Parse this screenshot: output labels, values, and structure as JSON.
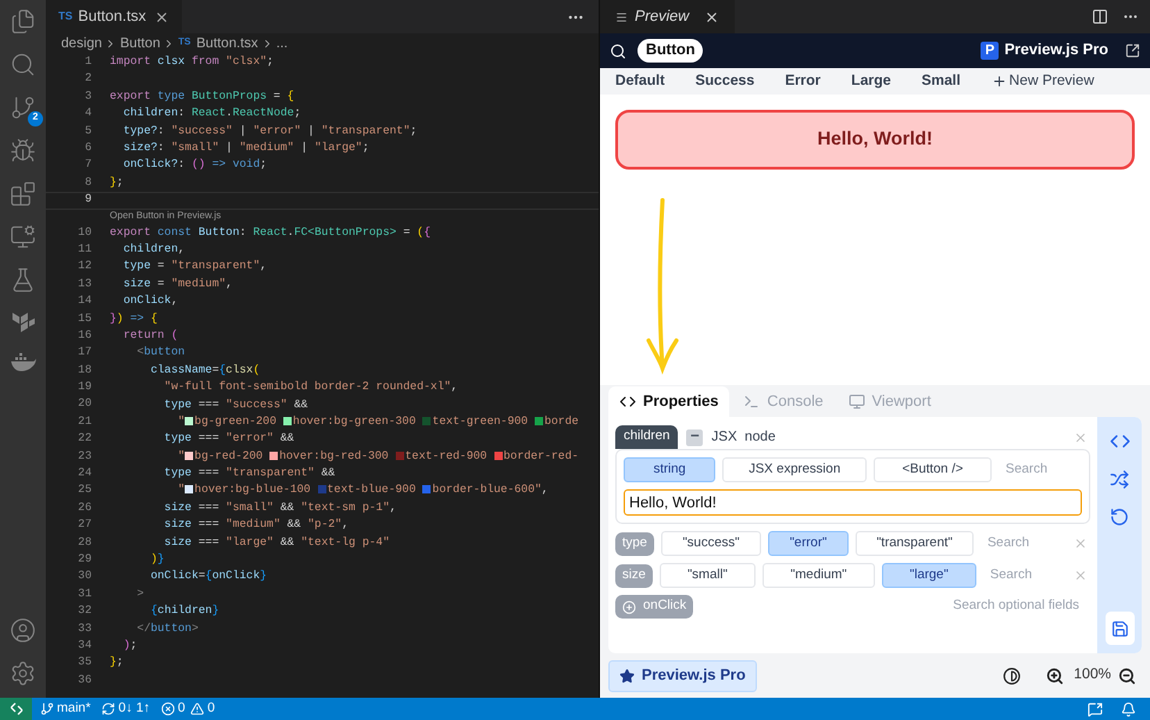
{
  "activity_bar": {
    "source_control_badge": "2"
  },
  "editor": {
    "tab": {
      "lang": "TS",
      "title": "Button.tsx"
    },
    "breadcrumb": [
      {
        "text": "design"
      },
      {
        "text": "Button"
      },
      {
        "lang": "TS",
        "text": "Button.tsx"
      },
      {
        "text": "..."
      }
    ],
    "lines": [
      {
        "kind": "code",
        "number": "1",
        "current": false,
        "tokens": [
          {
            "kind": "kw",
            "text": "import"
          },
          {
            "kind": "var",
            "text": " clsx "
          },
          {
            "kind": "kw",
            "text": "from"
          },
          {
            "kind": "str",
            "text": " \"clsx\""
          },
          {
            "kind": "punct",
            "text": ";"
          }
        ]
      },
      {
        "kind": "code",
        "number": "2",
        "current": false
      },
      {
        "kind": "code",
        "number": "3",
        "current": false,
        "tokens": [
          {
            "kind": "kw",
            "text": "export"
          },
          {
            "kind": "kw2",
            "text": " type "
          },
          {
            "kind": "type",
            "text": "ButtonProps"
          },
          {
            "kind": "punct",
            "text": " = "
          },
          {
            "kind": "br1",
            "text": "{"
          }
        ]
      },
      {
        "kind": "code",
        "number": "4",
        "current": false,
        "tokens": [
          {
            "kind": "var",
            "text": "  children"
          },
          {
            "kind": "punct",
            "text": ": "
          },
          {
            "kind": "type",
            "text": "React"
          },
          {
            "kind": "punct",
            "text": "."
          },
          {
            "kind": "type",
            "text": "ReactNode"
          },
          {
            "kind": "punct",
            "text": ";"
          }
        ]
      },
      {
        "kind": "code",
        "number": "5",
        "current": false,
        "tokens": [
          {
            "kind": "var",
            "text": "  type?"
          },
          {
            "kind": "punct",
            "text": ": "
          },
          {
            "kind": "str",
            "text": "\"success\""
          },
          {
            "kind": "punct",
            "text": " | "
          },
          {
            "kind": "str",
            "text": "\"error\""
          },
          {
            "kind": "punct",
            "text": " | "
          },
          {
            "kind": "str",
            "text": "\"transparent\""
          },
          {
            "kind": "punct",
            "text": ";"
          }
        ]
      },
      {
        "kind": "code",
        "number": "6",
        "current": false,
        "tokens": [
          {
            "kind": "var",
            "text": "  size?"
          },
          {
            "kind": "punct",
            "text": ": "
          },
          {
            "kind": "str",
            "text": "\"small\""
          },
          {
            "kind": "punct",
            "text": " | "
          },
          {
            "kind": "str",
            "text": "\"medium\""
          },
          {
            "kind": "punct",
            "text": " | "
          },
          {
            "kind": "str",
            "text": "\"large\""
          },
          {
            "kind": "punct",
            "text": ";"
          }
        ]
      },
      {
        "kind": "code",
        "number": "7",
        "current": false,
        "tokens": [
          {
            "kind": "var",
            "text": "  onClick?"
          },
          {
            "kind": "punct",
            "text": ": "
          },
          {
            "kind": "br2",
            "text": "()"
          },
          {
            "kind": "kw2",
            "text": " => void"
          },
          {
            "kind": "punct",
            "text": ";"
          }
        ]
      },
      {
        "kind": "code",
        "number": "8",
        "current": false,
        "tokens": [
          {
            "kind": "br1",
            "text": "}"
          },
          {
            "kind": "punct",
            "text": ";"
          }
        ]
      },
      {
        "kind": "code",
        "number": "9",
        "current": true
      },
      {
        "kind": "codelens",
        "text": "Open Button in Preview.js"
      },
      {
        "kind": "code",
        "number": "10",
        "current": false,
        "tokens": [
          {
            "kind": "kw",
            "text": "export"
          },
          {
            "kind": "kw2",
            "text": " const "
          },
          {
            "kind": "var",
            "text": "Button"
          },
          {
            "kind": "punct",
            "text": ": "
          },
          {
            "kind": "type",
            "text": "React"
          },
          {
            "kind": "punct",
            "text": "."
          },
          {
            "kind": "type",
            "text": "FC<ButtonProps>"
          },
          {
            "kind": "punct",
            "text": " = "
          },
          {
            "kind": "br1",
            "text": "("
          },
          {
            "kind": "br2",
            "text": "{"
          }
        ]
      },
      {
        "kind": "code",
        "number": "11",
        "current": false,
        "tokens": [
          {
            "kind": "var",
            "text": "  children"
          },
          {
            "kind": "punct",
            "text": ","
          }
        ]
      },
      {
        "kind": "code",
        "number": "12",
        "current": false,
        "tokens": [
          {
            "kind": "var",
            "text": "  type"
          },
          {
            "kind": "punct",
            "text": " = "
          },
          {
            "kind": "str",
            "text": "\"transparent\""
          },
          {
            "kind": "punct",
            "text": ","
          }
        ]
      },
      {
        "kind": "code",
        "number": "13",
        "current": false,
        "tokens": [
          {
            "kind": "var",
            "text": "  size"
          },
          {
            "kind": "punct",
            "text": " = "
          },
          {
            "kind": "str",
            "text": "\"medium\""
          },
          {
            "kind": "punct",
            "text": ","
          }
        ]
      },
      {
        "kind": "code",
        "number": "14",
        "current": false,
        "tokens": [
          {
            "kind": "var",
            "text": "  onClick"
          },
          {
            "kind": "punct",
            "text": ","
          }
        ]
      },
      {
        "kind": "code",
        "number": "15",
        "current": false,
        "tokens": [
          {
            "kind": "br2",
            "text": "}"
          },
          {
            "kind": "br1",
            "text": ")"
          },
          {
            "kind": "kw2",
            "text": " => "
          },
          {
            "kind": "br1",
            "text": "{"
          }
        ]
      },
      {
        "kind": "code",
        "number": "16",
        "current": false,
        "tokens": [
          {
            "kind": "kw",
            "text": "  return "
          },
          {
            "kind": "br2",
            "text": "("
          }
        ]
      },
      {
        "kind": "code",
        "number": "17",
        "current": false,
        "tokens": [
          {
            "kind": "tagp",
            "text": "    <"
          },
          {
            "kind": "tag",
            "text": "button"
          }
        ]
      },
      {
        "kind": "code",
        "number": "18",
        "current": false,
        "tokens": [
          {
            "kind": "var",
            "text": "      className"
          },
          {
            "kind": "punct",
            "text": "="
          },
          {
            "kind": "br3",
            "text": "{"
          },
          {
            "kind": "fn",
            "text": "clsx"
          },
          {
            "kind": "br1",
            "text": "("
          }
        ]
      },
      {
        "kind": "code",
        "number": "19",
        "current": false,
        "tokens": [
          {
            "kind": "str",
            "text": "        \"w-full font-semibold border-2 rounded-xl\""
          },
          {
            "kind": "punct",
            "text": ","
          }
        ]
      },
      {
        "kind": "code",
        "number": "20",
        "current": false,
        "tokens": [
          {
            "kind": "var",
            "text": "        type"
          },
          {
            "kind": "punct",
            "text": " === "
          },
          {
            "kind": "str",
            "text": "\"success\""
          },
          {
            "kind": "punct",
            "text": " &&"
          }
        ]
      },
      {
        "kind": "code",
        "number": "21",
        "current": false,
        "tokens": [
          {
            "kind": "str",
            "text": "          \""
          },
          {
            "kind": "swatch",
            "color": "#bbf7d0"
          },
          {
            "kind": "str",
            "text": "bg-green-200 "
          },
          {
            "kind": "swatch",
            "color": "#86efac"
          },
          {
            "kind": "str",
            "text": "hover:bg-green-300 "
          },
          {
            "kind": "swatch",
            "color": "#14532d"
          },
          {
            "kind": "str",
            "text": "text-green-900 "
          },
          {
            "kind": "swatch",
            "color": "#16a34a"
          },
          {
            "kind": "str",
            "text": "borde"
          }
        ]
      },
      {
        "kind": "code",
        "number": "22",
        "current": false,
        "tokens": [
          {
            "kind": "var",
            "text": "        type"
          },
          {
            "kind": "punct",
            "text": " === "
          },
          {
            "kind": "str",
            "text": "\"error\""
          },
          {
            "kind": "punct",
            "text": " &&"
          }
        ]
      },
      {
        "kind": "code",
        "number": "23",
        "current": false,
        "tokens": [
          {
            "kind": "str",
            "text": "          \""
          },
          {
            "kind": "swatch",
            "color": "#fecaca"
          },
          {
            "kind": "str",
            "text": "bg-red-200 "
          },
          {
            "kind": "swatch",
            "color": "#fca5a5"
          },
          {
            "kind": "str",
            "text": "hover:bg-red-300 "
          },
          {
            "kind": "swatch",
            "color": "#7f1d1d"
          },
          {
            "kind": "str",
            "text": "text-red-900 "
          },
          {
            "kind": "swatch",
            "color": "#ef4444"
          },
          {
            "kind": "str",
            "text": "border-red-"
          }
        ]
      },
      {
        "kind": "code",
        "number": "24",
        "current": false,
        "tokens": [
          {
            "kind": "var",
            "text": "        type"
          },
          {
            "kind": "punct",
            "text": " === "
          },
          {
            "kind": "str",
            "text": "\"transparent\""
          },
          {
            "kind": "punct",
            "text": " &&"
          }
        ]
      },
      {
        "kind": "code",
        "number": "25",
        "current": false,
        "tokens": [
          {
            "kind": "str",
            "text": "          \""
          },
          {
            "kind": "swatch",
            "color": "#dbeafe"
          },
          {
            "kind": "str",
            "text": "hover:bg-blue-100 "
          },
          {
            "kind": "swatch",
            "color": "#1e3a8a"
          },
          {
            "kind": "str",
            "text": "text-blue-900 "
          },
          {
            "kind": "swatch",
            "color": "#2563eb"
          },
          {
            "kind": "str",
            "text": "border-blue-600\""
          },
          {
            "kind": "punct",
            "text": ","
          }
        ]
      },
      {
        "kind": "code",
        "number": "26",
        "current": false,
        "tokens": [
          {
            "kind": "var",
            "text": "        size"
          },
          {
            "kind": "punct",
            "text": " === "
          },
          {
            "kind": "str",
            "text": "\"small\""
          },
          {
            "kind": "punct",
            "text": " && "
          },
          {
            "kind": "str",
            "text": "\"text-sm p-1\""
          },
          {
            "kind": "punct",
            "text": ","
          }
        ]
      },
      {
        "kind": "code",
        "number": "27",
        "current": false,
        "tokens": [
          {
            "kind": "var",
            "text": "        size"
          },
          {
            "kind": "punct",
            "text": " === "
          },
          {
            "kind": "str",
            "text": "\"medium\""
          },
          {
            "kind": "punct",
            "text": " && "
          },
          {
            "kind": "str",
            "text": "\"p-2\""
          },
          {
            "kind": "punct",
            "text": ","
          }
        ]
      },
      {
        "kind": "code",
        "number": "28",
        "current": false,
        "tokens": [
          {
            "kind": "var",
            "text": "        size"
          },
          {
            "kind": "punct",
            "text": " === "
          },
          {
            "kind": "str",
            "text": "\"large\""
          },
          {
            "kind": "punct",
            "text": " && "
          },
          {
            "kind": "str",
            "text": "\"text-lg p-4\""
          }
        ]
      },
      {
        "kind": "code",
        "number": "29",
        "current": false,
        "tokens": [
          {
            "kind": "br1",
            "text": "      )"
          },
          {
            "kind": "br3",
            "text": "}"
          }
        ]
      },
      {
        "kind": "code",
        "number": "30",
        "current": false,
        "tokens": [
          {
            "kind": "var",
            "text": "      onClick"
          },
          {
            "kind": "punct",
            "text": "="
          },
          {
            "kind": "br3",
            "text": "{"
          },
          {
            "kind": "var",
            "text": "onClick"
          },
          {
            "kind": "br3",
            "text": "}"
          }
        ]
      },
      {
        "kind": "code",
        "number": "31",
        "current": false,
        "tokens": [
          {
            "kind": "tagp",
            "text": "    >"
          }
        ]
      },
      {
        "kind": "code",
        "number": "32",
        "current": false,
        "tokens": [
          {
            "kind": "br3",
            "text": "      {"
          },
          {
            "kind": "var",
            "text": "children"
          },
          {
            "kind": "br3",
            "text": "}"
          }
        ]
      },
      {
        "kind": "code",
        "number": "33",
        "current": false,
        "tokens": [
          {
            "kind": "tagp",
            "text": "    </"
          },
          {
            "kind": "tag",
            "text": "button"
          },
          {
            "kind": "tagp",
            "text": ">"
          }
        ]
      },
      {
        "kind": "code",
        "number": "34",
        "current": false,
        "tokens": [
          {
            "kind": "br2",
            "text": "  )"
          },
          {
            "kind": "punct",
            "text": ";"
          }
        ]
      },
      {
        "kind": "code",
        "number": "35",
        "current": false,
        "tokens": [
          {
            "kind": "br1",
            "text": "}"
          },
          {
            "kind": "punct",
            "text": ";"
          }
        ]
      },
      {
        "kind": "code",
        "number": "36",
        "current": false
      }
    ]
  },
  "preview": {
    "tab_title": "Preview",
    "component": "Button",
    "logo_letter": "P",
    "brand": "Preview.js Pro",
    "variants": [
      {
        "label": "Default",
        "selected": false
      },
      {
        "label": "Success",
        "selected": false
      },
      {
        "label": "Error",
        "selected": false
      },
      {
        "label": "Large",
        "selected": false
      },
      {
        "label": "Small",
        "selected": false
      }
    ],
    "new_variant": "New Preview",
    "button_text": "Hello, World!"
  },
  "panel": {
    "tabs": [
      {
        "label": "Properties",
        "selected": true
      },
      {
        "label": "Console",
        "selected": false
      },
      {
        "label": "Viewport",
        "selected": false
      }
    ],
    "children": {
      "label": "children",
      "checkbox_mark": "−",
      "checked": true,
      "kind_text": "JSX  node",
      "options": [
        {
          "label": "string",
          "selected": true
        },
        {
          "label": "JSX expression",
          "selected": false
        },
        {
          "label": "<Button />",
          "selected": false
        }
      ],
      "search_placeholder": "Search",
      "value": "Hello, World!"
    },
    "fields": [
      {
        "label": "type",
        "options": [
          {
            "label": "\"success\"",
            "selected": false
          },
          {
            "label": "\"error\"",
            "selected": true
          },
          {
            "label": "\"transparent\"",
            "selected": false
          }
        ],
        "search_placeholder": "Search"
      },
      {
        "label": "size",
        "options": [
          {
            "label": "\"small\"",
            "selected": false
          },
          {
            "label": "\"medium\"",
            "selected": false
          },
          {
            "label": "\"large\"",
            "selected": true
          }
        ],
        "search_placeholder": "Search"
      }
    ],
    "optional": {
      "label": "onClick",
      "search_placeholder": "Search optional fields"
    }
  },
  "footer": {
    "pro_button": "Preview.js Pro",
    "zoom": "100%"
  },
  "status_bar": {
    "branch": "main*",
    "sync": "0↓ 1↑",
    "errors": "0",
    "warnings": "0"
  }
}
